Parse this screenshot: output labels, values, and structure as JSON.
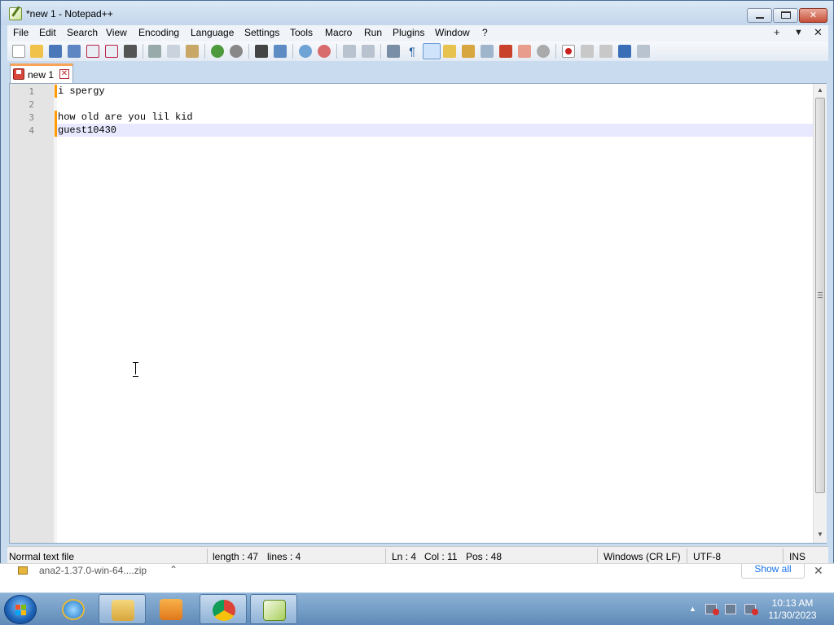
{
  "window": {
    "title": "*new 1 - Notepad++",
    "minimize_glyph": "",
    "close_glyph": "✕"
  },
  "menu": {
    "items": [
      "File",
      "Edit",
      "Search",
      "View",
      "Encoding",
      "Language",
      "Settings",
      "Tools",
      "Macro",
      "Run",
      "Plugins",
      "Window",
      "?"
    ],
    "right_plus": "+",
    "right_down": "▼",
    "right_close": "✕"
  },
  "tab": {
    "label": "new 1",
    "close_glyph": "✕"
  },
  "editor": {
    "line_numbers": [
      "1",
      "2",
      "3",
      "4"
    ],
    "lines": [
      "i spergy",
      "",
      "how old are you lil kid",
      "guest10430"
    ],
    "current_line": 4,
    "scroll_up": "▲",
    "scroll_down": "▼"
  },
  "status": {
    "file_type": "Normal text file",
    "length": "length : 47",
    "lines": "lines : 4",
    "ln": "Ln : 4",
    "col": "Col : 11",
    "pos": "Pos : 48",
    "eol": "Windows (CR LF)",
    "encoding": "UTF-8",
    "mode": "INS"
  },
  "download": {
    "filename": "ana2-1.37.0-win-64....zip",
    "caret": "⌃",
    "show_all": "Show all",
    "close_glyph": "✕"
  },
  "taskbar": {
    "tray_caret": "▲",
    "time": "10:13 AM",
    "date": "11/30/2023"
  },
  "colors": {
    "accent": "#f9a35b",
    "current_line": "#e8e8ff",
    "change_marker": "#ff9a00"
  }
}
